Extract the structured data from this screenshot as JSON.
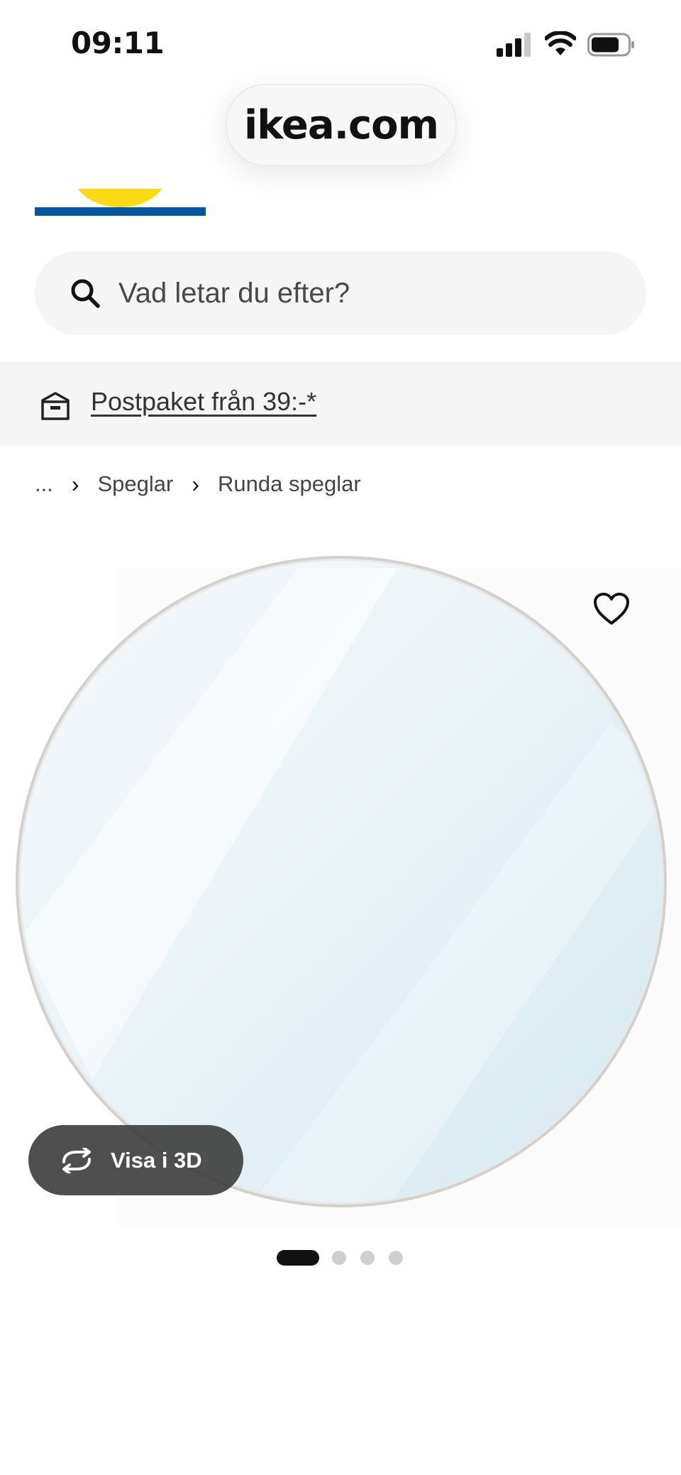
{
  "status_bar": {
    "time": "09:11"
  },
  "browser": {
    "url": "ikea.com"
  },
  "search": {
    "placeholder": "Vad letar du efter?"
  },
  "promo": {
    "text": "Postpaket från 39:-*"
  },
  "breadcrumb": {
    "ellipsis": "...",
    "items": [
      "Speglar",
      "Runda speglar"
    ]
  },
  "gallery": {
    "view_3d_label": "Visa i 3D",
    "total_images": 4,
    "active_index": 0
  },
  "icons": [
    "signal-icon",
    "wifi-icon",
    "battery-icon",
    "search-icon",
    "box-icon",
    "heart-icon",
    "rotate-icon"
  ],
  "colors": {
    "brand_blue": "#0058a3",
    "brand_yellow": "#fbd914",
    "dark_button": "#3c3c3c"
  }
}
